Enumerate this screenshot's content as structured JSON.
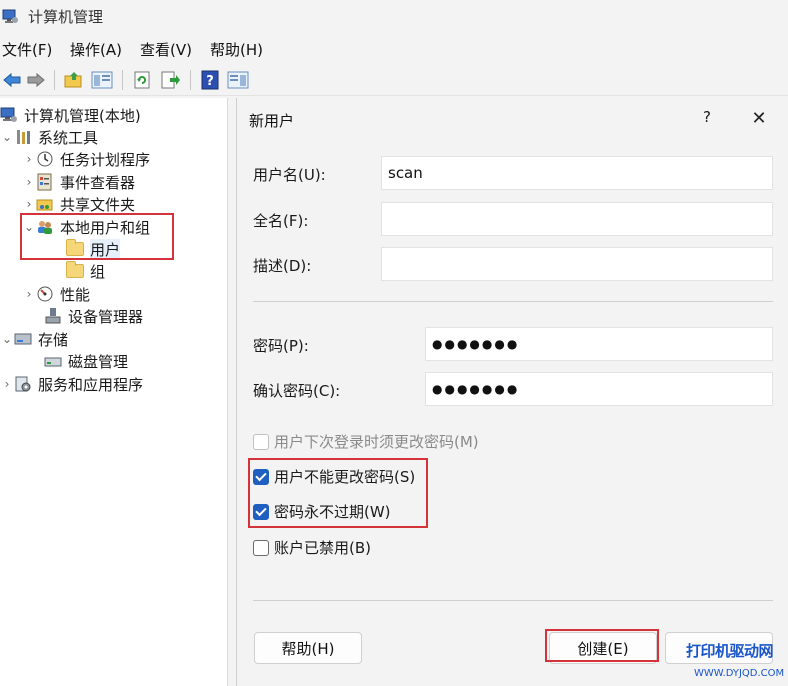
{
  "window": {
    "title": "计算机管理",
    "icon": "computer-management-icon"
  },
  "menu": [
    "文件(F)",
    "操作(A)",
    "查看(V)",
    "帮助(H)"
  ],
  "toolbar": {
    "icons": [
      "back-arrow-icon",
      "forward-arrow-icon",
      "up-folder-icon",
      "show-hide-tree-icon",
      "refresh-icon",
      "export-list-icon",
      "help-icon",
      "properties-pane-icon"
    ]
  },
  "tree": {
    "root": "计算机管理(本地)",
    "system_tools": "系统工具",
    "task_scheduler": "任务计划程序",
    "event_viewer": "事件查看器",
    "shared_folders": "共享文件夹",
    "local_users_groups": "本地用户和组",
    "users": "用户",
    "groups": "组",
    "performance": "性能",
    "device_manager": "设备管理器",
    "storage": "存储",
    "disk_management": "磁盘管理",
    "services_apps": "服务和应用程序"
  },
  "dialog": {
    "title": "新用户",
    "help_glyph": "?",
    "close_glyph": "✕",
    "username_label": "用户名(U):",
    "username_value": "scan",
    "fullname_label": "全名(F):",
    "fullname_value": "",
    "description_label": "描述(D):",
    "description_value": "",
    "password_label": "密码(P):",
    "password_value": "●●●●●●●",
    "confirm_label": "确认密码(C):",
    "confirm_value": "●●●●●●●",
    "must_change_label": "用户下次登录时须更改密码(M)",
    "must_change_checked": false,
    "must_change_enabled": false,
    "cannot_change_label": "用户不能更改密码(S)",
    "cannot_change_checked": true,
    "never_expires_label": "密码永不过期(W)",
    "never_expires_checked": true,
    "disabled_label": "账户已禁用(B)",
    "disabled_checked": false,
    "help_button": "帮助(H)",
    "create_button": "创建(E)"
  },
  "watermark": {
    "main": "打印机驱动网",
    "sub": "WWW.DYJQD.COM"
  },
  "colors": {
    "highlight_box": "#d4333a",
    "checkbox_checked": "#1f5fbf",
    "watermark": "#1a56c8"
  }
}
